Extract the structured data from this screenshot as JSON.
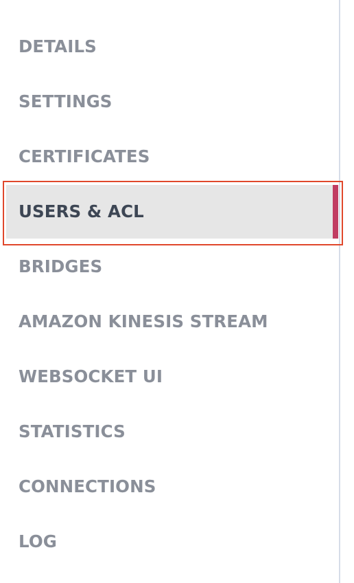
{
  "sidebar": {
    "items": [
      {
        "label": "DETAILS",
        "active": false
      },
      {
        "label": "SETTINGS",
        "active": false
      },
      {
        "label": "CERTIFICATES",
        "active": false
      },
      {
        "label": "USERS & ACL",
        "active": true
      },
      {
        "label": "BRIDGES",
        "active": false
      },
      {
        "label": "AMAZON KINESIS STREAM",
        "active": false
      },
      {
        "label": "WEBSOCKET UI",
        "active": false
      },
      {
        "label": "STATISTICS",
        "active": false
      },
      {
        "label": "CONNECTIONS",
        "active": false
      },
      {
        "label": "LOG",
        "active": false
      }
    ]
  },
  "colors": {
    "inactive_text": "#8a8f99",
    "active_text": "#3d4654",
    "active_background": "#e6e6e6",
    "active_indicator": "#c13d63",
    "highlight_outline": "#e0472b",
    "divider": "#d6dde8"
  }
}
